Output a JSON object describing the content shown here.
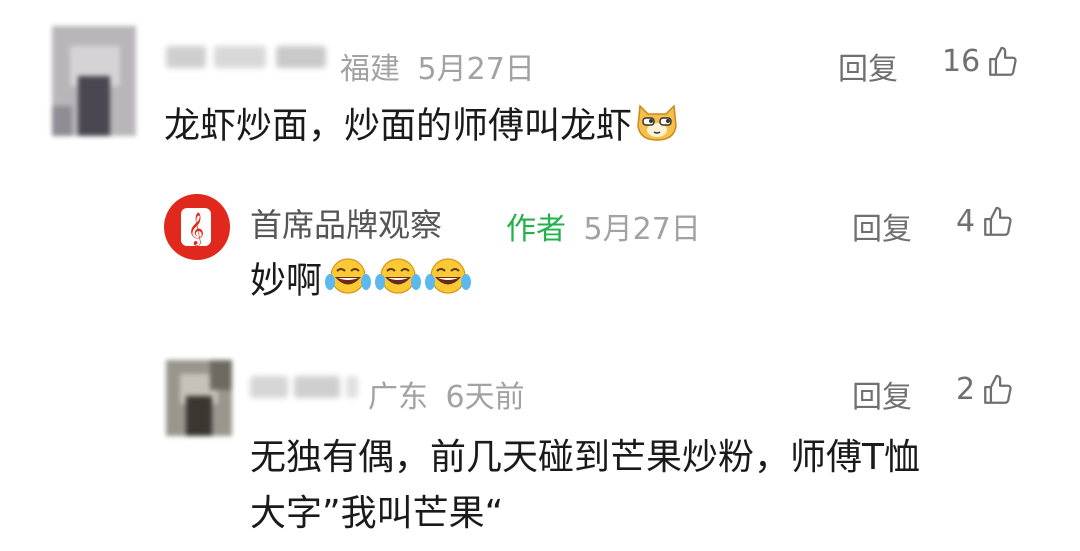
{
  "comments": [
    {
      "location": "福建",
      "date": "5月27日",
      "reply_label": "回复",
      "likes": "16",
      "text": "龙虾炒面，炒面的师傅叫龙虾",
      "emoji": "doge-sunglasses-emoji"
    },
    {
      "author": "首席品牌观察",
      "author_tag": "作者",
      "date": "5月27日",
      "reply_label": "回复",
      "likes": "4",
      "text": "妙啊",
      "emoji": "laughing-tears-emoji"
    },
    {
      "location": "广东",
      "date": "6天前",
      "reply_label": "回复",
      "likes": "2",
      "text_line1": "无独有偶，前几天碰到芒果炒粉，师傅T恤",
      "text_line2": "大字”我叫芒果“"
    }
  ],
  "colors": {
    "author_tag": "#22b14c",
    "meta": "#a2a2a2",
    "brand_logo": "#e0281c"
  }
}
